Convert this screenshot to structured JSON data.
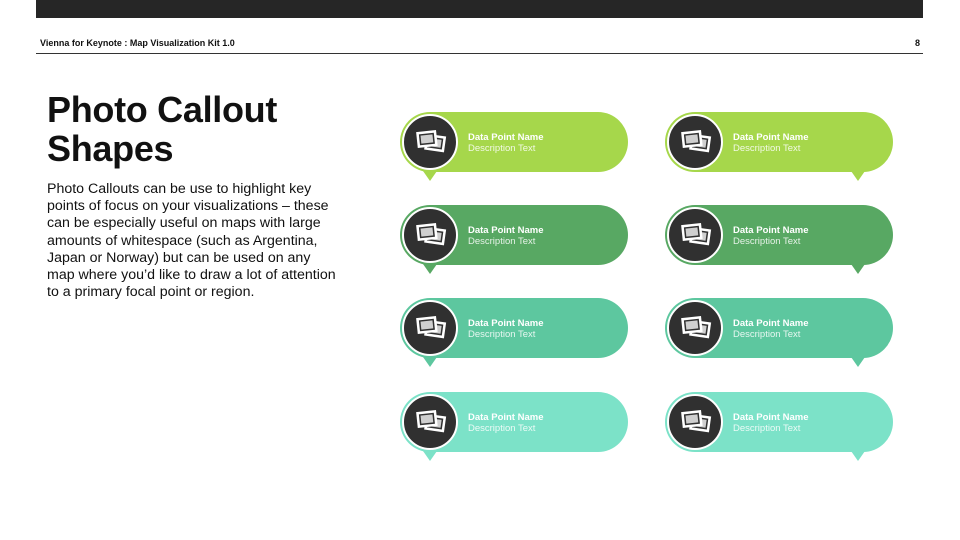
{
  "header": {
    "title": "Vienna for Keynote : Map Visualization Kit 1.0",
    "page_number": "8"
  },
  "slide": {
    "title": "Photo Callout Shapes",
    "body": "Photo Callouts can be use to highlight key points of focus on your visualizations – these can be especially useful on maps with large amounts of whitespace (such as Argentina, Japan or Norway) but can be used on any map where you’d like to draw a lot of attention to a primary focal point or region."
  },
  "callouts": [
    {
      "name": "Data Point Name",
      "description": "Description Text",
      "color": "#A6D74B",
      "icon": "photo-stack-icon",
      "tail": "left"
    },
    {
      "name": "Data Point Name",
      "description": "Description Text",
      "color": "#A6D74B",
      "icon": "photo-stack-icon",
      "tail": "right"
    },
    {
      "name": "Data Point Name",
      "description": "Description Text",
      "color": "#58A863",
      "icon": "photo-stack-icon",
      "tail": "left"
    },
    {
      "name": "Data Point Name",
      "description": "Description Text",
      "color": "#58A863",
      "icon": "photo-stack-icon",
      "tail": "right"
    },
    {
      "name": "Data Point Name",
      "description": "Description Text",
      "color": "#5DC79F",
      "icon": "photo-stack-icon",
      "tail": "left"
    },
    {
      "name": "Data Point Name",
      "description": "Description Text",
      "color": "#5DC79F",
      "icon": "photo-stack-icon",
      "tail": "right"
    },
    {
      "name": "Data Point Name",
      "description": "Description Text",
      "color": "#7CE2C8",
      "icon": "photo-stack-icon",
      "tail": "left"
    },
    {
      "name": "Data Point Name",
      "description": "Description Text",
      "color": "#7CE2C8",
      "icon": "photo-stack-icon",
      "tail": "right"
    }
  ]
}
